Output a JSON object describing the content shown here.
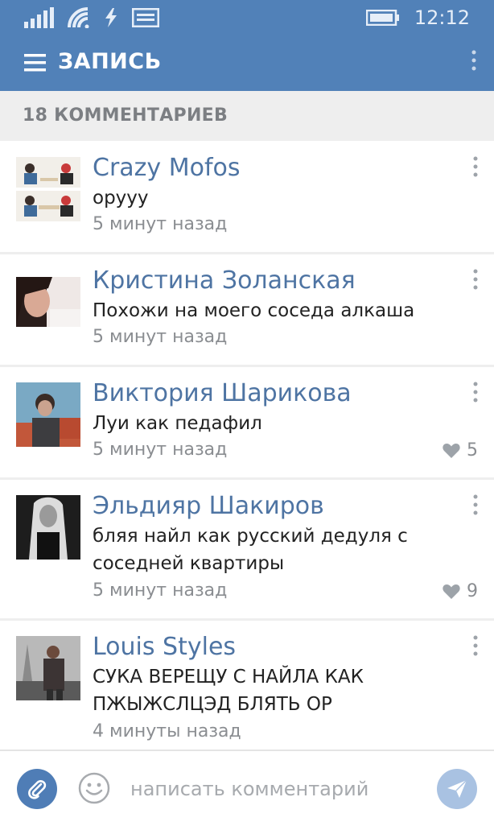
{
  "status_bar": {
    "time": "12:12",
    "icons": [
      "signal-icon",
      "wifi-icon",
      "data-icon",
      "message-icon",
      "battery-icon"
    ]
  },
  "app_bar": {
    "title": "ЗАПИСЬ",
    "menu_icon": "hamburger-menu-icon",
    "more_icon": "more-vertical-icon"
  },
  "comments_header": {
    "count_label": "18 КОММЕНТАРИЕВ"
  },
  "comments": [
    {
      "author": "Crazy Mofos",
      "text": "оруyy",
      "time": "5 минут назад",
      "likes": ""
    },
    {
      "author": "Кристина Золанская",
      "text": "Похожи на моего соседа алкаша",
      "time": "5 минут назад",
      "likes": ""
    },
    {
      "author": "Виктория Шарикова",
      "text": "Луи как педафил",
      "time": "5 минут назад",
      "likes": "5"
    },
    {
      "author": "Эльдияр Шакиров",
      "text": "бляя найл как русский дедуля с соседней квартиры",
      "time": "5 минут назад",
      "likes": "9"
    },
    {
      "author": "Louis Styles",
      "text": "СУКА ВЕРЕЩУ С НАЙЛА КАК ПЖЫЖСЛЦЭД БЛЯТЬ ОР",
      "time": "4 минуты назад",
      "likes": ""
    }
  ],
  "composer": {
    "placeholder": "написать комментарий",
    "attach_icon": "paperclip-icon",
    "emoji_icon": "smile-icon",
    "send_icon": "send-icon"
  },
  "colors": {
    "header_blue": "#5181b8",
    "name_blue": "#4e74a3",
    "attach_blue": "#4f7db6",
    "send_disabled_blue": "#a9c2e2",
    "secondary_gray": "#8a8d91",
    "header_bg_gray": "#eeeeee"
  }
}
